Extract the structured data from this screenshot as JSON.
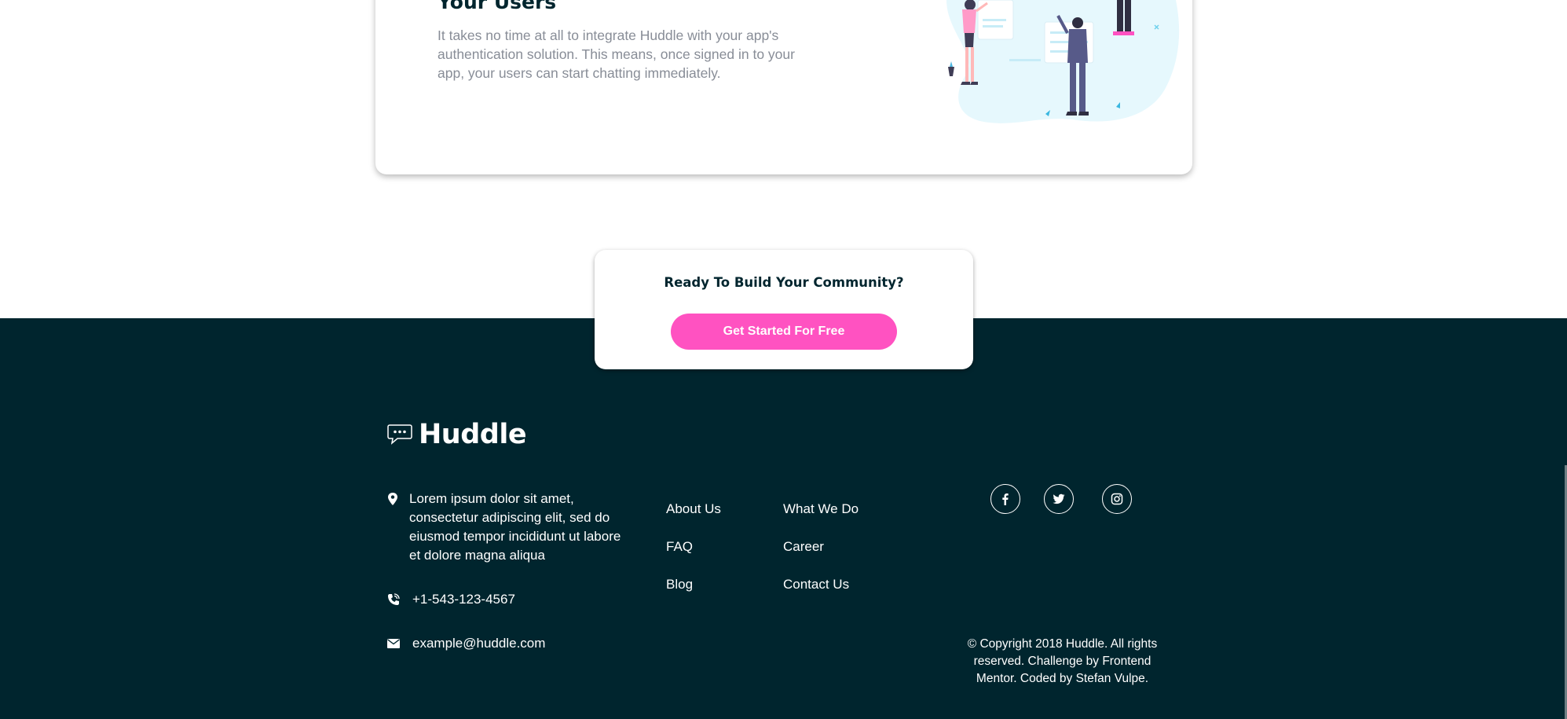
{
  "feature": {
    "title": "Your Users",
    "text": "It takes no time at all to integrate Huddle with your app's authentication solution. This means, once signed in to your app, your users can start chatting immediately."
  },
  "cta": {
    "title": "Ready To Build Your Community?",
    "button_label": "Get Started For Free"
  },
  "footer": {
    "logo_text": "Huddle",
    "address": "Lorem ipsum dolor sit amet, consectetur adipiscing elit, sed do eiusmod tempor incididunt ut labore et dolore magna aliqua",
    "phone": "+1-543-123-4567",
    "email": "example@huddle.com",
    "links_col1": [
      "About Us",
      "FAQ",
      "Blog"
    ],
    "links_col2": [
      "What We Do",
      "Career",
      "Contact Us"
    ],
    "social": [
      "facebook-icon",
      "twitter-icon",
      "instagram-icon"
    ],
    "copyright": "© Copyright 2018 Huddle. All rights reserved. Challenge by Frontend Mentor. Coded by Stefan Vulpe."
  },
  "colors": {
    "accent": "#ff52c1",
    "footer_bg": "#00252e",
    "heading": "#00252e",
    "muted_text": "#888d97"
  }
}
